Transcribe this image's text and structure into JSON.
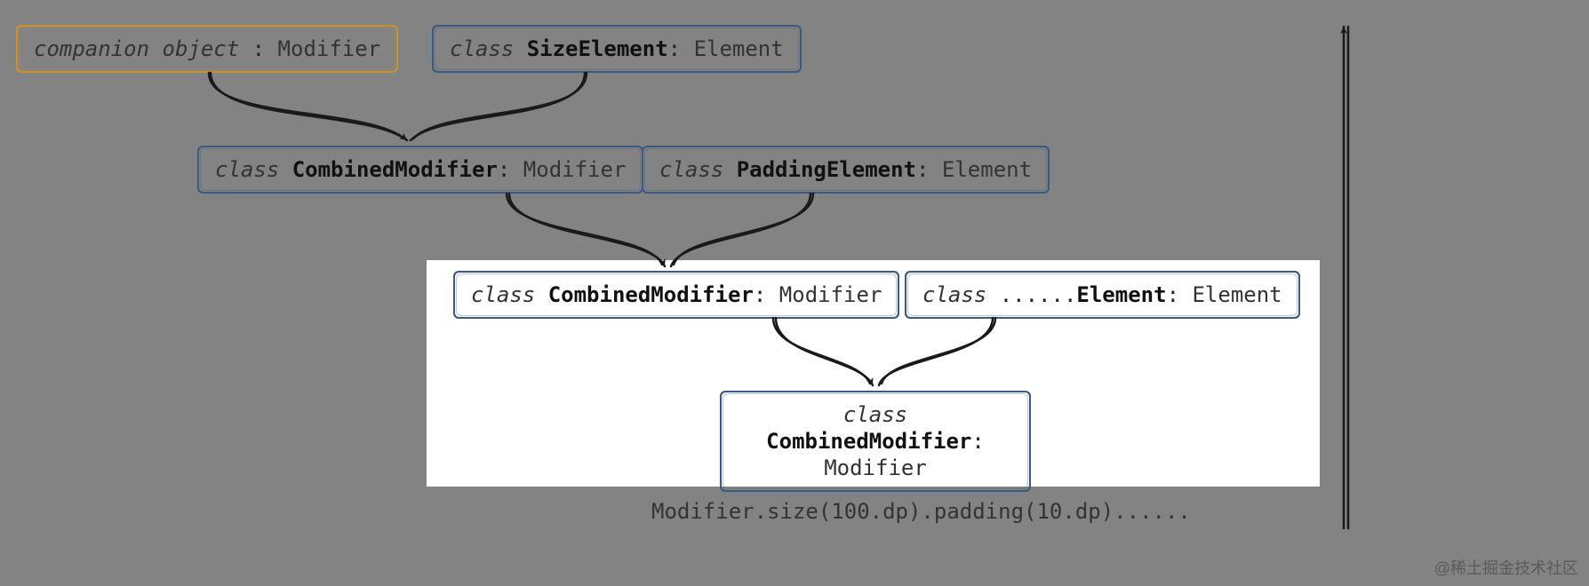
{
  "nodes": {
    "n1": {
      "kw": "companion object",
      "sep": " : ",
      "typ": "Modifier"
    },
    "n2": {
      "kw": "class ",
      "cls": "SizeElement",
      "sep": ": ",
      "typ": "Element"
    },
    "n3": {
      "kw": "class ",
      "cls": "CombinedModifier",
      "sep": ": ",
      "typ": "Modifier"
    },
    "n4": {
      "kw": "class ",
      "cls": "PaddingElement",
      "sep": ": ",
      "typ": "Element"
    },
    "n5": {
      "kw": "class ",
      "cls": "CombinedModifier",
      "sep": ": ",
      "typ": "Modifier"
    },
    "n6": {
      "kw": "class ",
      "dots": "......",
      "cls": "Element",
      "sep": ": ",
      "typ": "Element"
    },
    "n7": {
      "kw": "class ",
      "cls": "CombinedModifier",
      "sep": ":",
      "typ": "Modifier"
    }
  },
  "caption": "Modifier.size(100.dp).padding(10.dp)......",
  "watermark": "@稀土掘金技术社区"
}
